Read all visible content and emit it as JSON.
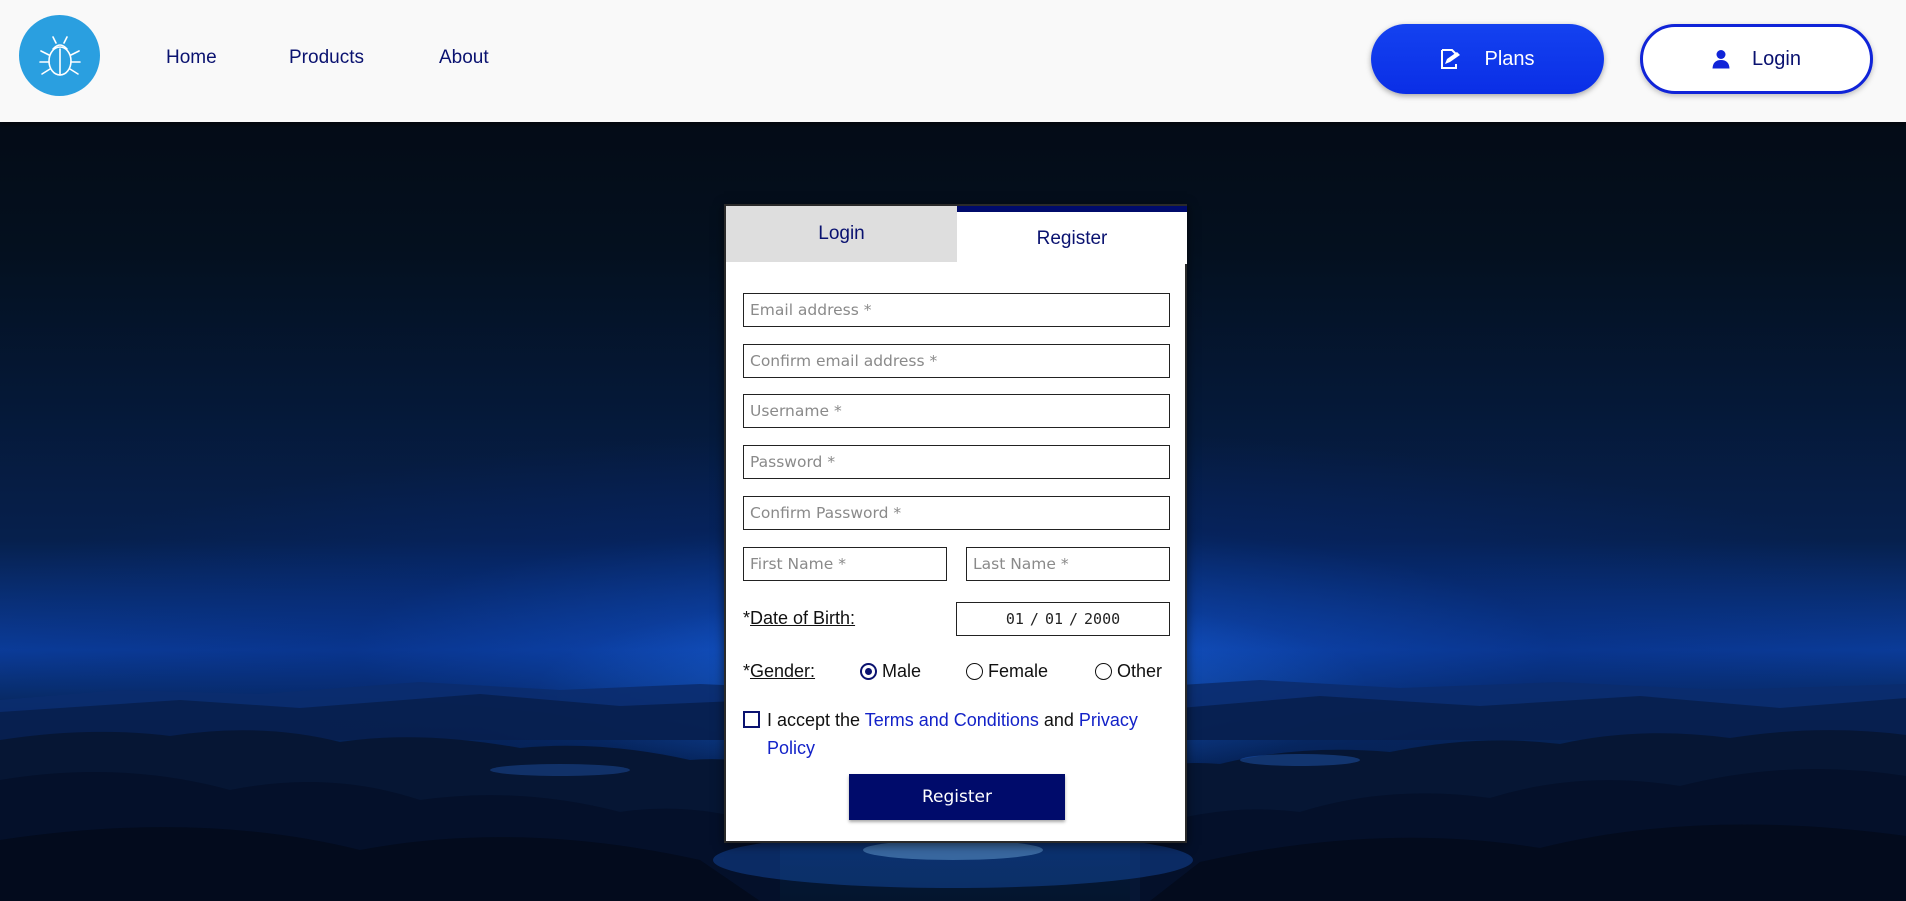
{
  "header": {
    "nav": [
      "Home",
      "Products",
      "About"
    ],
    "plans_label": "Plans",
    "login_label": "Login",
    "logo_icon": "bug-icon",
    "colors": {
      "logo_bg": "#2a9fe0",
      "primary": "#0a2ee6",
      "nav_text": "#0a1270"
    }
  },
  "card": {
    "tabs": {
      "login": "Login",
      "register": "Register",
      "active": "Register"
    },
    "fields": {
      "email": {
        "placeholder": "Email address *",
        "value": ""
      },
      "confirm_email": {
        "placeholder": "Confirm email address *",
        "value": ""
      },
      "username": {
        "placeholder": "Username *",
        "value": ""
      },
      "password": {
        "placeholder": "Password *",
        "value": ""
      },
      "confirm_password": {
        "placeholder": "Confirm Password *",
        "value": ""
      },
      "first_name": {
        "placeholder": "First Name *",
        "value": ""
      },
      "last_name": {
        "placeholder": "Last Name *",
        "value": ""
      }
    },
    "dob": {
      "prefix": "*",
      "label": "Date of Birth:",
      "month": "01",
      "day": "01",
      "year": "2000",
      "sep": "/"
    },
    "gender": {
      "prefix": "*",
      "label": "Gender:",
      "options": [
        "Male",
        "Female",
        "Other"
      ],
      "selected": "Male"
    },
    "terms": {
      "prefix": "I accept the",
      "terms_link": "Terms and Conditions",
      "middle": "and",
      "privacy_link": "Privacy Policy",
      "checked": false
    },
    "submit_label": "Register",
    "colors": {
      "accent": "#000b6b",
      "link": "#1322c8"
    }
  }
}
